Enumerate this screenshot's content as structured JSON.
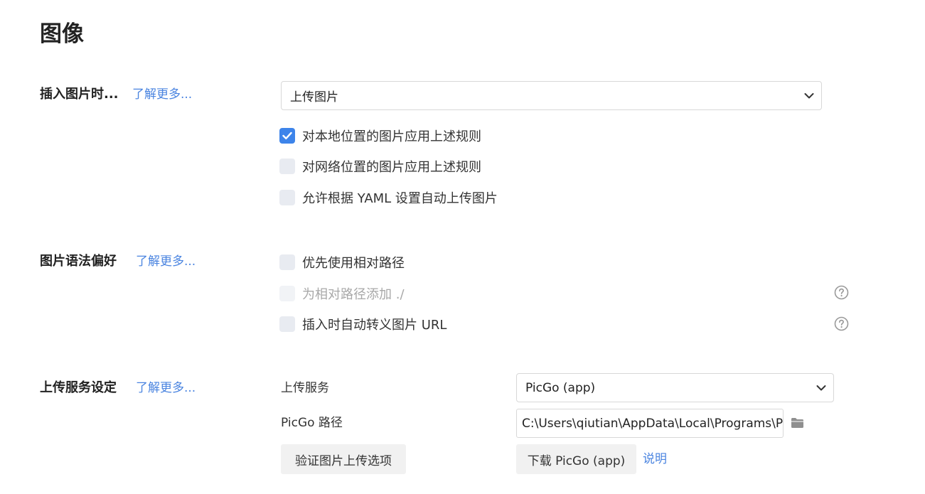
{
  "page": {
    "title": "图像"
  },
  "insert_section": {
    "label": "插入图片时...",
    "learn_more": "了解更多...",
    "action_select": {
      "value": "上传图片"
    },
    "options": [
      {
        "label": "对本地位置的图片应用上述规则",
        "checked": true,
        "disabled": false
      },
      {
        "label": "对网络位置的图片应用上述规则",
        "checked": false,
        "disabled": false
      },
      {
        "label": "允许根据 YAML 设置自动上传图片",
        "checked": false,
        "disabled": false
      }
    ]
  },
  "syntax_section": {
    "label": "图片语法偏好",
    "learn_more": "了解更多...",
    "options": [
      {
        "label": "优先使用相对路径",
        "checked": false,
        "disabled": false
      },
      {
        "label": "为相对路径添加 ./",
        "checked": false,
        "disabled": true
      },
      {
        "label": "插入时自动转义图片 URL",
        "checked": false,
        "disabled": false
      }
    ]
  },
  "upload_section": {
    "label": "上传服务设定",
    "learn_more": "了解更多...",
    "service_label": "上传服务",
    "service_select": {
      "value": "PicGo (app)"
    },
    "path_label": "PicGo 路径",
    "path_value": "C:\\Users\\qiutian\\AppData\\Local\\Programs\\Pi",
    "verify_button": "验证图片上传选项",
    "download_button": "下载 PicGo (app)",
    "help_link": "说明"
  },
  "icons": {
    "check": "check-icon",
    "chevron": "chevron-down-icon",
    "help": "question-circle-icon",
    "folder": "folder-icon"
  },
  "colors": {
    "accent": "#3d84ea",
    "link": "#4a84e0",
    "checkbox_off": "#e8ebf1",
    "button_bg": "#f1f1f1"
  }
}
